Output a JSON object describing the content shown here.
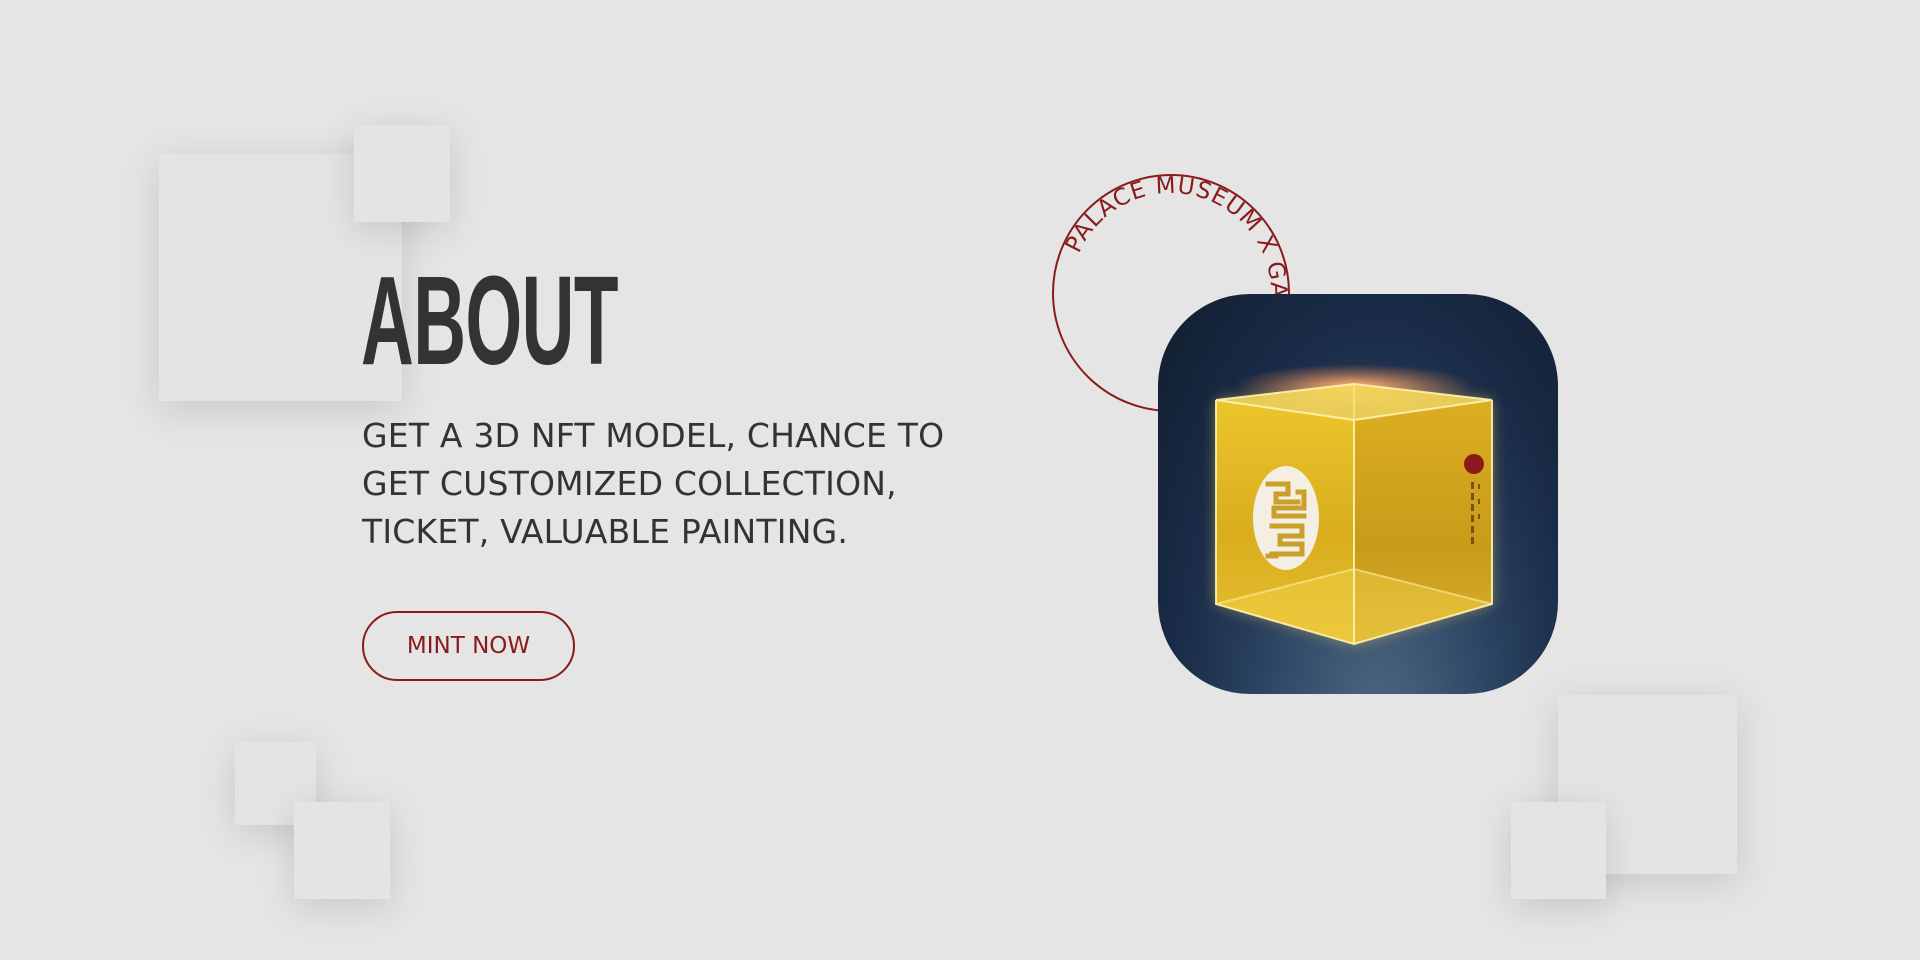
{
  "about": {
    "heading": "ABOUT",
    "description": "GET A 3D NFT MODEL, CHANCE TO\nGET CUSTOMIZED COLLECTION,\nTICKET, VALUABLE PAINTING.",
    "cta_label": "MINT NOW"
  },
  "stamp": {
    "text": "PALACE MUSEUM X GASH X"
  },
  "artwork": {
    "icon": "golden-cube-nft-image"
  },
  "colors": {
    "background": "#e5e5e5",
    "text": "#333333",
    "accent": "#8b1a1a",
    "cube_gold": "#e0b824",
    "art_background": "#1a2c48"
  }
}
